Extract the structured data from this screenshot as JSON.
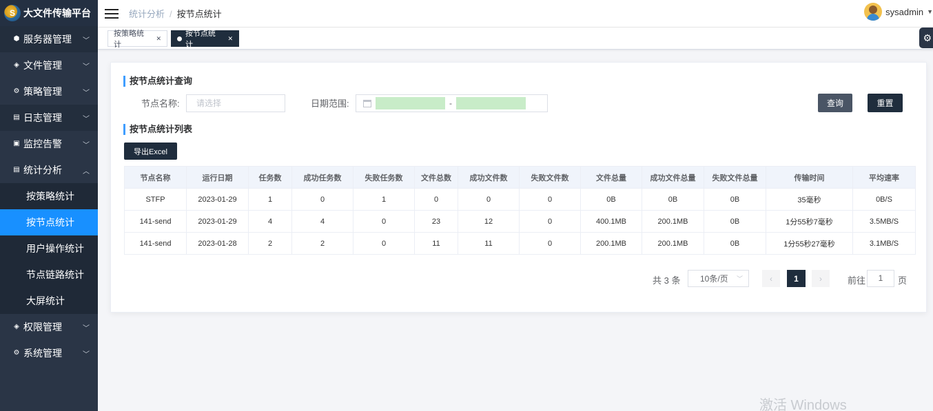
{
  "app": {
    "title": "大文件传输平台",
    "logo_letter": "S"
  },
  "sidebar": {
    "items": [
      {
        "label": "服务器管理",
        "icon": "cube-icon"
      },
      {
        "label": "文件管理",
        "icon": "layers-icon"
      },
      {
        "label": "策略管理",
        "icon": "strategy-icon"
      },
      {
        "label": "日志管理",
        "icon": "log-icon"
      },
      {
        "label": "监控告警",
        "icon": "monitor-icon"
      },
      {
        "label": "统计分析",
        "icon": "stats-icon"
      },
      {
        "label": "权限管理",
        "icon": "permission-icon"
      },
      {
        "label": "系统管理",
        "icon": "system-icon"
      }
    ],
    "sub_items": [
      {
        "label": "按策略统计"
      },
      {
        "label": "按节点统计"
      },
      {
        "label": "用户操作统计"
      },
      {
        "label": "节点链路统计"
      },
      {
        "label": "大屏统计"
      }
    ]
  },
  "header": {
    "breadcrumb_parent": "统计分析",
    "breadcrumb_sep": "/",
    "breadcrumb_current": "按节点统计",
    "username": "sysadmin"
  },
  "tags": [
    {
      "label": "按策略统计"
    },
    {
      "label": "按节点统计"
    }
  ],
  "query": {
    "title": "按节点统计查询",
    "node_label": "节点名称:",
    "node_placeholder": "请选择",
    "date_label": "日期范围:",
    "date_sep": "-",
    "query_btn": "查询",
    "reset_btn": "重置"
  },
  "list": {
    "title": "按节点统计列表",
    "export_btn": "导出Excel",
    "columns": [
      "节点名称",
      "运行日期",
      "任务数",
      "成功任务数",
      "失败任务数",
      "文件总数",
      "成功文件数",
      "失败文件数",
      "文件总量",
      "成功文件总量",
      "失败文件总量",
      "传输时间",
      "平均速率"
    ],
    "rows": [
      [
        "STFP",
        "2023-01-29",
        "1",
        "0",
        "1",
        "0",
        "0",
        "0",
        "0B",
        "0B",
        "0B",
        "35毫秒",
        "0B/S"
      ],
      [
        "141-send",
        "2023-01-29",
        "4",
        "4",
        "0",
        "23",
        "12",
        "0",
        "400.1MB",
        "200.1MB",
        "0B",
        "1分55秒7毫秒",
        "3.5MB/S"
      ],
      [
        "141-send",
        "2023-01-28",
        "2",
        "2",
        "0",
        "11",
        "11",
        "0",
        "200.1MB",
        "200.1MB",
        "0B",
        "1分55秒27毫秒",
        "3.1MB/S"
      ]
    ]
  },
  "pagination": {
    "total": "共 3 条",
    "page_size": "10条/页",
    "prev": "‹",
    "current_page": "1",
    "next": "›",
    "goto_label": "前往",
    "goto_value": "1",
    "goto_unit": "页"
  },
  "watermark": "激活 Windows"
}
